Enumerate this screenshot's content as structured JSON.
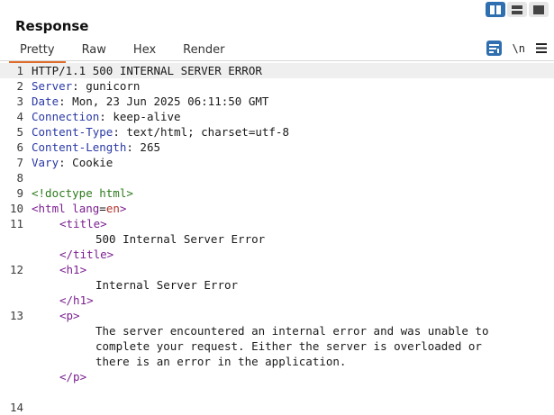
{
  "panel": {
    "title": "Response"
  },
  "layout_toggle": [
    "split-horizontal-icon",
    "split-vertical-icon",
    "single-pane-icon"
  ],
  "tabs": [
    {
      "label": "Pretty",
      "active": true
    },
    {
      "label": "Raw"
    },
    {
      "label": "Hex"
    },
    {
      "label": "Render"
    }
  ],
  "tools": {
    "newline_label": "\\n"
  },
  "lines": {
    "l1": "1",
    "l2": "2",
    "l3": "3",
    "l4": "4",
    "l5": "5",
    "l6": "6",
    "l7": "7",
    "l8": "8",
    "l9": "9",
    "l10": "10",
    "l11": "11",
    "l12": "12",
    "l13": "13",
    "l14": "14"
  },
  "response": {
    "status_line": "HTTP/1.1 500 INTERNAL SERVER ERROR",
    "headers": [
      {
        "name": "Server",
        "value": " gunicorn"
      },
      {
        "name": "Date",
        "value": " Mon, 23 Jun 2025 06:11:50 GMT"
      },
      {
        "name": "Connection",
        "value": " keep-alive"
      },
      {
        "name": "Content-Type",
        "value": " text/html; charset=utf-8"
      },
      {
        "name": "Content-Length",
        "value": " 265"
      },
      {
        "name": "Vary",
        "value": " Cookie"
      }
    ],
    "body": {
      "doctype": "<!doctype html>",
      "html_open": "<html",
      "lang_attr": " lang",
      "lang_eq": "=",
      "lang_val": "en",
      "html_close_bracket": ">",
      "title_open": "<title>",
      "title_text": "500 Internal Server Error",
      "title_close": "</title>",
      "h1_open": "<h1>",
      "h1_text": "Internal Server Error",
      "h1_close": "</h1>",
      "p_open": "<p>",
      "p_text_1": "The server encountered an internal error and was unable to",
      "p_text_2": "complete your request. Either the server is overloaded or",
      "p_text_3": "there is an error in the application.",
      "p_close": "</p>"
    }
  },
  "colors": {
    "accent": "#2f6fb0",
    "tab_underline": "#e06c2b",
    "header_name": "#2a39a5",
    "tag": "#7a1f8f",
    "doctype": "#2f7a1e"
  }
}
